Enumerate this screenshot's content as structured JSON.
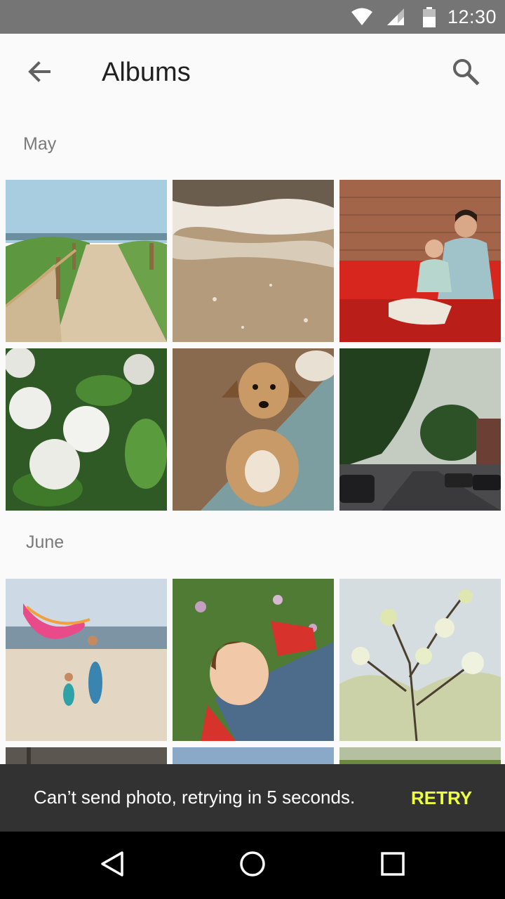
{
  "status_bar": {
    "time": "12:30",
    "icons": [
      "wifi-icon",
      "signal-icon",
      "battery-icon"
    ]
  },
  "app_bar": {
    "title": "Albums",
    "back_icon": "arrow-back-icon",
    "search_icon": "search-icon"
  },
  "sections": [
    {
      "label": "May",
      "photos": [
        "beach-path",
        "ocean-waves",
        "mother-and-child-sofa",
        "white-flowers",
        "dog-sitting",
        "tree-lined-street"
      ]
    },
    {
      "label": "June",
      "photos": [
        "beach-scarf",
        "girl-in-grass",
        "blossoming-tree",
        "wood-plank",
        "blue-sky",
        "green-foliage"
      ]
    }
  ],
  "snackbar": {
    "message": "Can’t send photo, retrying in 5 seconds.",
    "action": "RETRY",
    "action_color": "#eeff41"
  },
  "nav_bar": {
    "icons": [
      "nav-back-icon",
      "nav-home-icon",
      "nav-recents-icon"
    ]
  },
  "colors": {
    "status_bar": "#757575",
    "background": "#fafafa",
    "snackbar": "#323232",
    "nav_bar": "#000000"
  }
}
